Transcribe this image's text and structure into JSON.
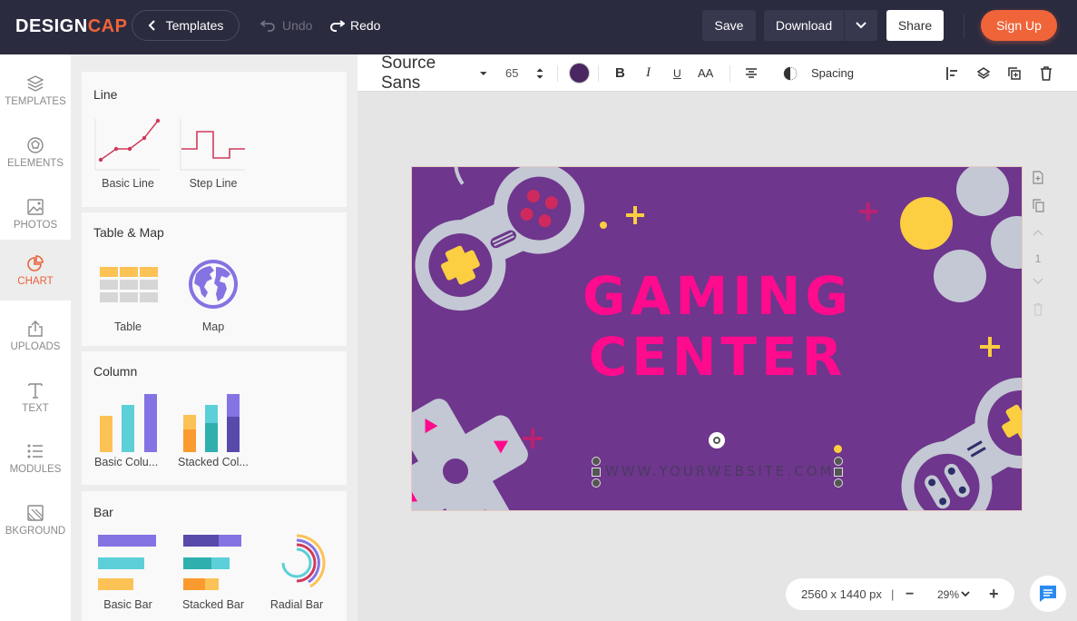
{
  "header": {
    "logo_main": "DESIGN",
    "logo_accent": "CAP",
    "templates_label": "Templates",
    "undo_label": "Undo",
    "redo_label": "Redo",
    "save_label": "Save",
    "download_label": "Download",
    "share_label": "Share",
    "signup_label": "Sign Up"
  },
  "nav": {
    "items": [
      {
        "label": "TEMPLATES",
        "icon": "layers-icon"
      },
      {
        "label": "ELEMENTS",
        "icon": "elements-icon"
      },
      {
        "label": "PHOTOS",
        "icon": "image-icon"
      },
      {
        "label": "CHART",
        "icon": "pie-chart-icon",
        "active": true
      },
      {
        "label": "UPLOADS",
        "icon": "upload-icon"
      },
      {
        "label": "TEXT",
        "icon": "text-icon"
      },
      {
        "label": "MODULES",
        "icon": "list-icon"
      },
      {
        "label": "BKGROUND",
        "icon": "background-icon"
      }
    ]
  },
  "panel": {
    "sections": [
      {
        "title": "Line",
        "items": [
          "Basic Line",
          "Step Line"
        ]
      },
      {
        "title": "Table & Map",
        "items": [
          "Table",
          "Map"
        ]
      },
      {
        "title": "Column",
        "items": [
          "Basic Colu...",
          "Stacked Col..."
        ]
      },
      {
        "title": "Bar",
        "items": [
          "Basic Bar",
          "Stacked Bar",
          "Radial Bar"
        ]
      }
    ]
  },
  "toolbar": {
    "font_family": "Source Sans",
    "font_size": "65",
    "text_color": "#4a2760",
    "bold": "B",
    "italic": "I",
    "underline": "U",
    "case": "AA",
    "spacing_label": "Spacing"
  },
  "canvas": {
    "title_line1": "GAMING",
    "title_line2": "CENTER",
    "url_text": "WWW.YOURWEBSITE.COM",
    "background_color": "#6e368c",
    "title_color": "#ff0b8d"
  },
  "page_tools": {
    "page_number": "1"
  },
  "zoom": {
    "dimensions": "2560 x 1440 px",
    "separator": "|",
    "minus": "−",
    "level": "29%",
    "plus": "+"
  },
  "colors": {
    "accent": "#f0643a",
    "topbar": "#2b2b40",
    "chart_yellow": "#fcc256",
    "chart_teal": "#5ccfd9",
    "chart_purple": "#8473e3",
    "chart_red": "#cf3b5b"
  }
}
